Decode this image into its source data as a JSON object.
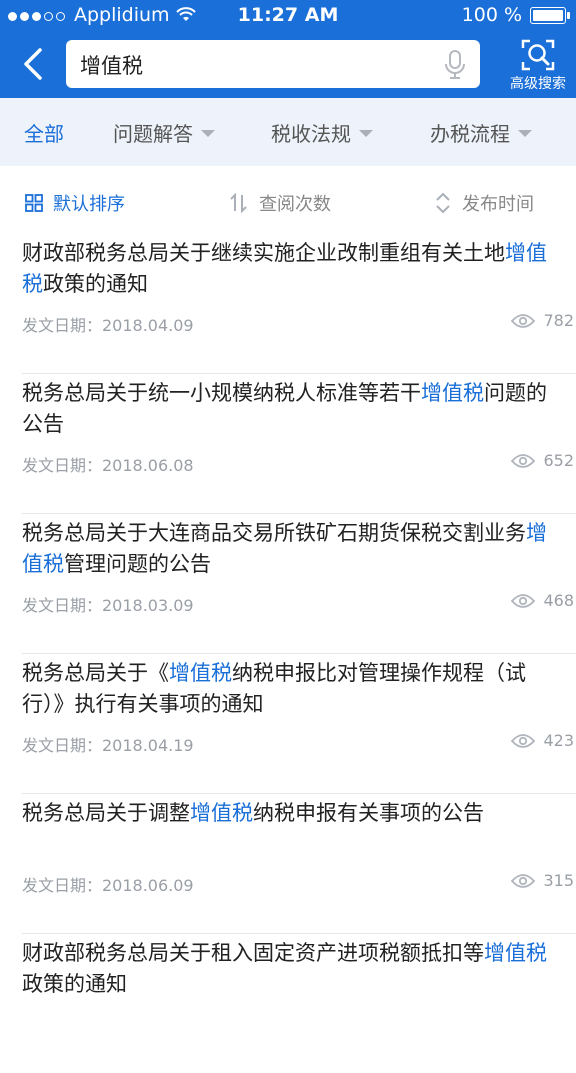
{
  "status": {
    "carrier": "Applidium",
    "time": "11:27 AM",
    "battery": "100 %"
  },
  "header": {
    "search_query": "增值税",
    "advanced_label": "高级搜索"
  },
  "tabs": [
    {
      "label": "全部",
      "active": true
    },
    {
      "label": "问题解答"
    },
    {
      "label": "税收法规"
    },
    {
      "label": "办税流程"
    }
  ],
  "sort": {
    "default_label": "默认排序",
    "views_label": "查阅次数",
    "time_label": "发布时间"
  },
  "items": [
    {
      "pre": "财政部税务总局关于继续实施企业改制重组有关土地",
      "hl": "增值税",
      "post": "政策的通知",
      "date": "发文日期：2018.04.09",
      "views": "782"
    },
    {
      "pre": "税务总局关于统一小规模纳税人标准等若干",
      "hl": "增值税",
      "post": "问题的公告",
      "date": "发文日期：2018.06.08",
      "views": "652"
    },
    {
      "pre": "税务总局关于大连商品交易所铁矿石期货保税交割业务",
      "hl": "增值税",
      "post": "管理问题的公告",
      "date": "发文日期：2018.03.09",
      "views": "468"
    },
    {
      "pre": "税务总局关于《",
      "hl": "增值税",
      "post": "纳税申报比对管理操作规程（试行）》执行有关事项的通知",
      "date": "发文日期：2018.04.19",
      "views": "423"
    },
    {
      "pre": "税务总局关于调整",
      "hl": "增值税",
      "post": "纳税申报有关事项的公告",
      "date": "发文日期：2018.06.09",
      "views": "315"
    },
    {
      "pre": "财政部税务总局关于租入固定资产进项税额抵扣等",
      "hl": "增值税",
      "post": "政策的通知",
      "date": "",
      "views": ""
    }
  ],
  "colors": {
    "accent": "#1a6fd8",
    "tab_bg": "#eef3fb"
  }
}
